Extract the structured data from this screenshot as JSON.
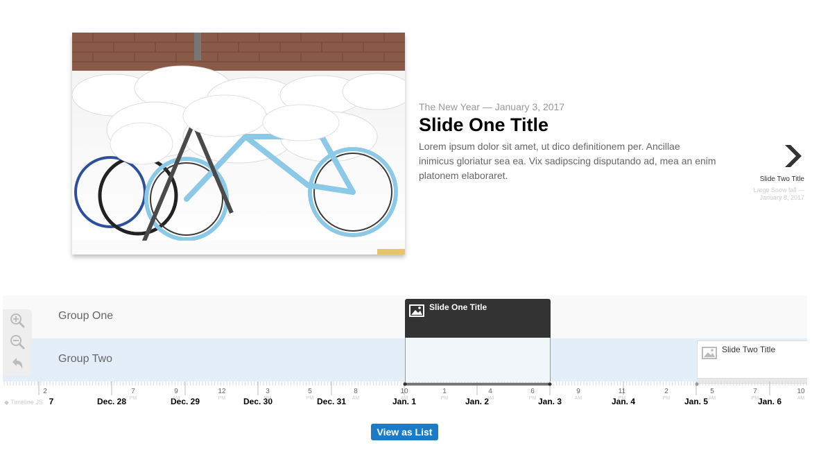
{
  "slide": {
    "date_line": "The New Year — January 3, 2017",
    "title": "Slide One Title",
    "body": "Lorem ipsum dolor sit amet, ut dico definitionem per. Ancillae inimicus gloriatur sea ea. Vix sadipscing disputando ad, mea an enim platonem elaboraret.",
    "image_icon": "snowy-bicycles-photo"
  },
  "next": {
    "title": "Slide Two Title",
    "date_line": "Large Snow fall — January 8, 2017",
    "icon": "chevron-right-icon"
  },
  "timeline": {
    "groups": [
      "Group One",
      "Group Two"
    ],
    "markers": [
      {
        "title": "Slide One Title",
        "icon": "image-icon"
      },
      {
        "title": "Slide Two Title",
        "icon": "image-icon"
      }
    ],
    "zoom_controls": [
      "zoom-in-icon",
      "zoom-out-icon",
      "back-icon"
    ],
    "major_labels": [
      "7",
      "Dec. 28",
      "Dec. 29",
      "Dec. 30",
      "Dec. 31",
      "Jan. 1",
      "Jan. 2",
      "Jan. 3",
      "Jan. 4",
      "Jan. 5",
      "Jan. 6"
    ],
    "minor_labels": [
      {
        "num": "2",
        "ampm": ""
      },
      {
        "num": "7",
        "ampm": "PM"
      },
      {
        "num": "9",
        "ampm": "AM"
      },
      {
        "num": "12",
        "ampm": "PM"
      },
      {
        "num": "3",
        "ampm": "PM"
      },
      {
        "num": "5",
        "ampm": "PM"
      },
      {
        "num": "8",
        "ampm": "AM"
      },
      {
        "num": "10",
        "ampm": "AM"
      },
      {
        "num": "1",
        "ampm": "PM"
      },
      {
        "num": "4",
        "ampm": "AM"
      },
      {
        "num": "6",
        "ampm": "PM"
      },
      {
        "num": "9",
        "ampm": "AM"
      },
      {
        "num": "11",
        "ampm": "PM"
      },
      {
        "num": "2",
        "ampm": "PM"
      },
      {
        "num": "5",
        "ampm": "AM"
      },
      {
        "num": "7",
        "ampm": "PM"
      },
      {
        "num": "10",
        "ampm": "AM"
      }
    ],
    "attribution": "Timeline JS"
  },
  "view_list_label": "View as List",
  "colors": {
    "marker_active": "#333333",
    "group_two_bg": "#e3eef8",
    "button_bg": "#1a7cc9"
  }
}
